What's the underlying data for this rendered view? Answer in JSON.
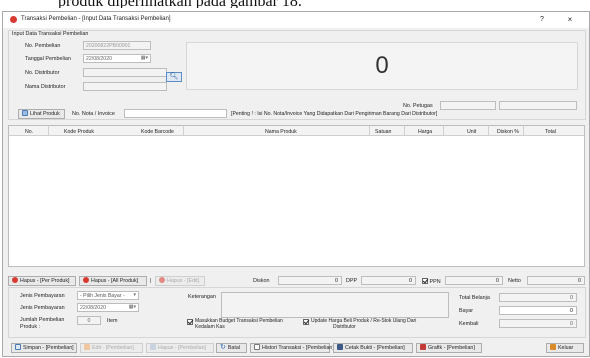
{
  "caption": "produk diperlihatkan pada gambar 18.",
  "window": {
    "title": "Transaksi Pembelian - [Input Data Transaksi Pembelian]",
    "help": "?",
    "close": "×"
  },
  "input_group": {
    "title": "Input Data Transaksi Pembelian",
    "no_pembelian_label": "No. Pembelian",
    "no_pembelian_value": "20200822PB00001",
    "tanggal_label": "Tanggal Pembelian",
    "tanggal_value": "22/08/2020",
    "distributor_label": "No. Distributor",
    "distributor_value": "",
    "nama_distributor_label": "Nama Distributor",
    "nama_distributor_value": "",
    "total_display": "0",
    "no_petugas_label": "No. Petugas",
    "no_petugas_value": ""
  },
  "toolbar": {
    "lihat_produk": "Lihat Produk",
    "nota_label": "No. Nota / Invoice",
    "nota_value": "",
    "note": "[Penting ! : Isi No. Nota/Invoice Yang Didapatkan Dari Pengiriman Barang Dari Distributor]"
  },
  "table": {
    "headers": [
      "No.",
      "Kode Produk",
      "Kode Barcode",
      "Nama Produk",
      "Satuan",
      "Harga",
      "Unit",
      "Diskon %",
      "Total"
    ],
    "rows": []
  },
  "mid_bar": {
    "hapus_per_produk": "Hapus - [Per Produk]",
    "hapus_all_produk": "Hapus - [All Produk]",
    "separator": "|",
    "hapus_edit": "Hapus - [Edit]",
    "diskon_label": "Diskon",
    "diskon_value": "0",
    "dpp_label": "DPP",
    "dpp_value": "0",
    "ppn_label": "PPN",
    "ppn_value": "0",
    "ppn_checked": true,
    "netto_label": "Netto",
    "netto_value": "0"
  },
  "payment": {
    "jenis_label": "Jenis Pembayaran",
    "jenis_value": "- Pilih Jenis Bayar -",
    "tanggal_label": "Jenis Pembayaran",
    "tanggal_value": "22/08/2020",
    "jumlah_label_1": "Jumlah Pembelian",
    "jumlah_label_2": "Produk :",
    "jumlah_value": "0",
    "jumlah_unit": "Item",
    "keterangan_label": "Keterangan",
    "keterangan_value": "",
    "budget_label_1": "Masukkan Budget Transaksi Pembelian",
    "budget_label_2": "Kedalam Kas",
    "budget_checked": true,
    "update_label_1": "Update Harga Beli Produk / Re-Stok Ulang Dari",
    "update_label_2": "Distributor",
    "update_checked": true,
    "total_belanja_label": "Total Belanja",
    "total_belanja_value": "0",
    "bayar_label": "Bayar",
    "bayar_value": "0",
    "kembali_label": "Kembali",
    "kembali_value": "0"
  },
  "bottom_bar": {
    "simpan": "Simpan - [Pembelian]",
    "edit": "Edit - [Pembelian]",
    "hapus": "Hapus - [Pembelian]",
    "batal": "Batal",
    "histori": "Histori Transaksi - [Pembelian]",
    "cetak": "Cetak Bukti - [Pembelian]",
    "grafik": "Grafik - [Pembelian]",
    "keluar": "Keluar"
  },
  "colors": {
    "accent_red": "#d83a32",
    "accent_blue": "#4a7cb8",
    "window_bg": "#f0f0f0"
  }
}
